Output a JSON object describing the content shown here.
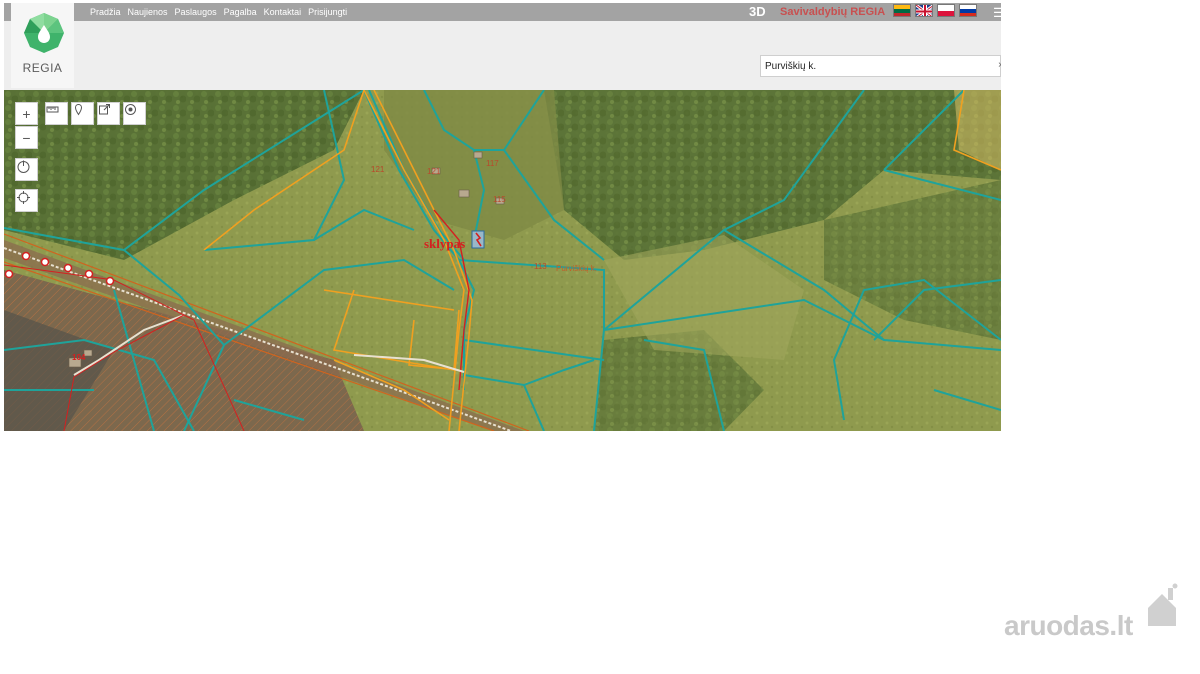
{
  "app": {
    "logo_text": "REGIA",
    "nav": [
      "Pradžia",
      "Naujienos",
      "Paslaugos",
      "Pagalba",
      "Kontaktai",
      "Prisijungti"
    ],
    "btn_3d": "3D",
    "brand": "Savivaldybių REGIA",
    "languages": [
      "lt-flag",
      "gb-flag",
      "pl-flag",
      "ru-flag"
    ],
    "menu_icon": "menu-icon"
  },
  "search": {
    "value": "Purviškių k.",
    "clear_icon": "close-icon"
  },
  "map": {
    "tools": [
      "zoom-in-icon",
      "zoom-out-icon",
      "measure-icon",
      "marker-icon",
      "export-icon",
      "target-icon",
      "power-icon",
      "crosshair-icon"
    ],
    "parcel_labels": [
      "121",
      "121",
      "117",
      "115",
      "113",
      "104"
    ],
    "plot_label": "sklypas",
    "village_label": "Purviškių k."
  },
  "watermark": {
    "text": "aruodas.lt"
  },
  "colors": {
    "topbar": "#a3a3a3",
    "brand": "#c85050",
    "parcel_line": "#1fa39a",
    "road_line": "#f0a020",
    "rail_line": "#d06020",
    "plot_label": "#d42020"
  }
}
